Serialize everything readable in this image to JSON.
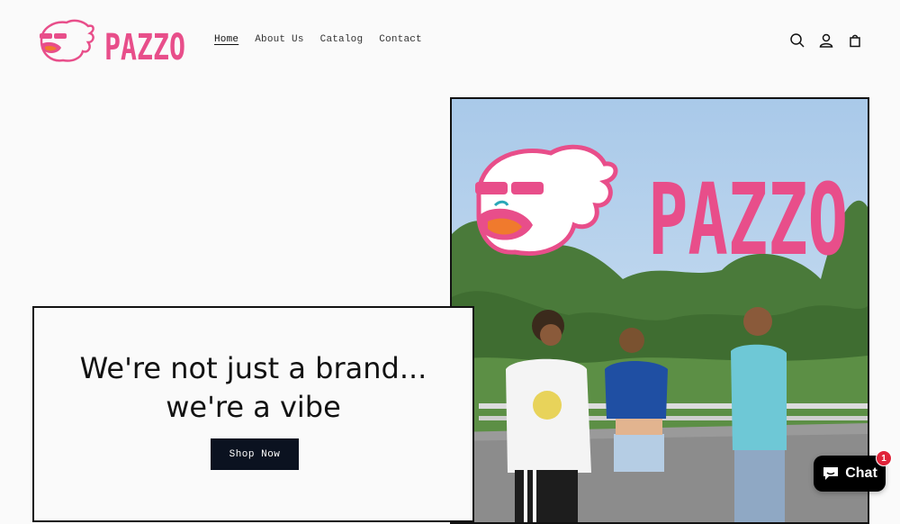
{
  "brand": {
    "name": "PAZZO",
    "color": "#e84e8a"
  },
  "nav": {
    "items": [
      {
        "label": "Home",
        "active": true
      },
      {
        "label": "About Us",
        "active": false
      },
      {
        "label": "Catalog",
        "active": false
      },
      {
        "label": "Contact",
        "active": false
      }
    ]
  },
  "header_icons": [
    "search-icon",
    "account-icon",
    "cart-icon"
  ],
  "hero": {
    "heading_line1": "We're not just a brand...",
    "heading_line2": "we're a vibe",
    "cta_label": "Shop Now",
    "image_logo_text": "PAZZO"
  },
  "chat": {
    "label": "Chat",
    "badge_count": "1"
  }
}
